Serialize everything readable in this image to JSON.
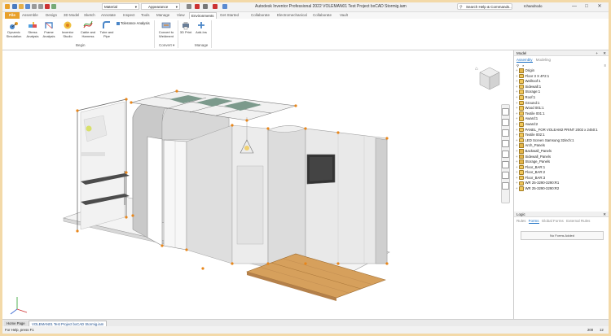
{
  "titlebar": {
    "title": "Autodesk Inventor Professional 2022   VOLEMAN01 Test Project bxCAD Stormig.iam",
    "material": "Material",
    "appearance": "Appearance",
    "search_placeholder": "Search Help & Commands...",
    "user": "Ichandrodo",
    "minimize": "—",
    "maximize": "□",
    "close": "✕"
  },
  "tabs": [
    {
      "label": "File",
      "kind": "file"
    },
    {
      "label": "Assemble"
    },
    {
      "label": "Design"
    },
    {
      "label": "3D Model"
    },
    {
      "label": "Sketch"
    },
    {
      "label": "Annotate"
    },
    {
      "label": "Inspect"
    },
    {
      "label": "Tools"
    },
    {
      "label": "Manage"
    },
    {
      "label": "View"
    },
    {
      "label": "Environments",
      "kind": "active"
    },
    {
      "label": "Get Started"
    },
    {
      "label": "Collaborate"
    },
    {
      "label": "Electromechanical"
    },
    {
      "label": "Collaborate"
    },
    {
      "label": "Vault"
    }
  ],
  "ribbon": {
    "buttons": [
      {
        "l1": "Dynamic",
        "l2": "Simulation"
      },
      {
        "l1": "Stress",
        "l2": "Analysis"
      },
      {
        "l1": "Frame",
        "l2": "Analysis"
      },
      {
        "l1": "Inventor",
        "l2": "Studio"
      },
      {
        "l1": "Cable and",
        "l2": "Harness"
      },
      {
        "l1": "Tube and",
        "l2": "Pipe"
      },
      {
        "l1": "Convert to",
        "l2": "Weldment"
      },
      {
        "l1": "3D Print",
        "l2": ""
      },
      {
        "l1": "Add-Ins",
        "l2": ""
      }
    ],
    "tolerance_label": "Tolerance Analysis",
    "groups": {
      "begin": "Begin",
      "convert": "Convert ▾",
      "manage": "Manage"
    }
  },
  "panel": {
    "title": "Model",
    "subtab_assembly": "Assembly",
    "subtab_modeling": "Modeling",
    "tree": [
      {
        "label": "Origin",
        "icon": "folder"
      },
      {
        "label": "Floor 3 X 4F2:1",
        "icon": "part"
      },
      {
        "label": "Wallroof:1",
        "icon": "part"
      },
      {
        "label": "Sidewall:1",
        "icon": "part"
      },
      {
        "label": "Storage:1",
        "icon": "part"
      },
      {
        "label": "Roof:1",
        "icon": "part"
      },
      {
        "label": "Ground:1",
        "icon": "part"
      },
      {
        "label": "Wood 001:1",
        "icon": "part"
      },
      {
        "label": "Textile 001:1",
        "icon": "part"
      },
      {
        "label": "Award:1",
        "icon": "part"
      },
      {
        "label": "Award:2",
        "icon": "part"
      },
      {
        "label": "PANEL_FOR VOLEAM2 PRINT 2002 x 2450:1",
        "icon": "part"
      },
      {
        "label": "Textile 002:1",
        "icon": "part"
      },
      {
        "label": "LED Screen Samsung 32inch:1",
        "icon": "part"
      },
      {
        "label": "Arch_Panels",
        "icon": "folder"
      },
      {
        "label": "Backwall_Panels",
        "icon": "folder"
      },
      {
        "label": "Sidewall_Panels",
        "icon": "folder"
      },
      {
        "label": "Storage_Panels",
        "icon": "folder"
      },
      {
        "label": "Floor_BAR:1",
        "icon": "part"
      },
      {
        "label": "Floor_BAR:2",
        "icon": "part"
      },
      {
        "label": "Floor_BAR:3",
        "icon": "part"
      },
      {
        "label": "WR 25-3290-3290:R1",
        "icon": "part"
      },
      {
        "label": "WR 25-3290-3290:R2",
        "icon": "part"
      }
    ],
    "logic_title": "Logic",
    "logic_tabs": [
      "Rules",
      "Forms",
      "Global Forms",
      "External Rules"
    ],
    "logic_button": "No Forms Added"
  },
  "doctabs": [
    {
      "label": "Home Page"
    },
    {
      "label": "VOLEMAN01 Test Project bxCAD Stormig.iam",
      "active": true
    }
  ],
  "status": {
    "text": "For Help, press F1",
    "count1": "200",
    "count2": "12"
  }
}
